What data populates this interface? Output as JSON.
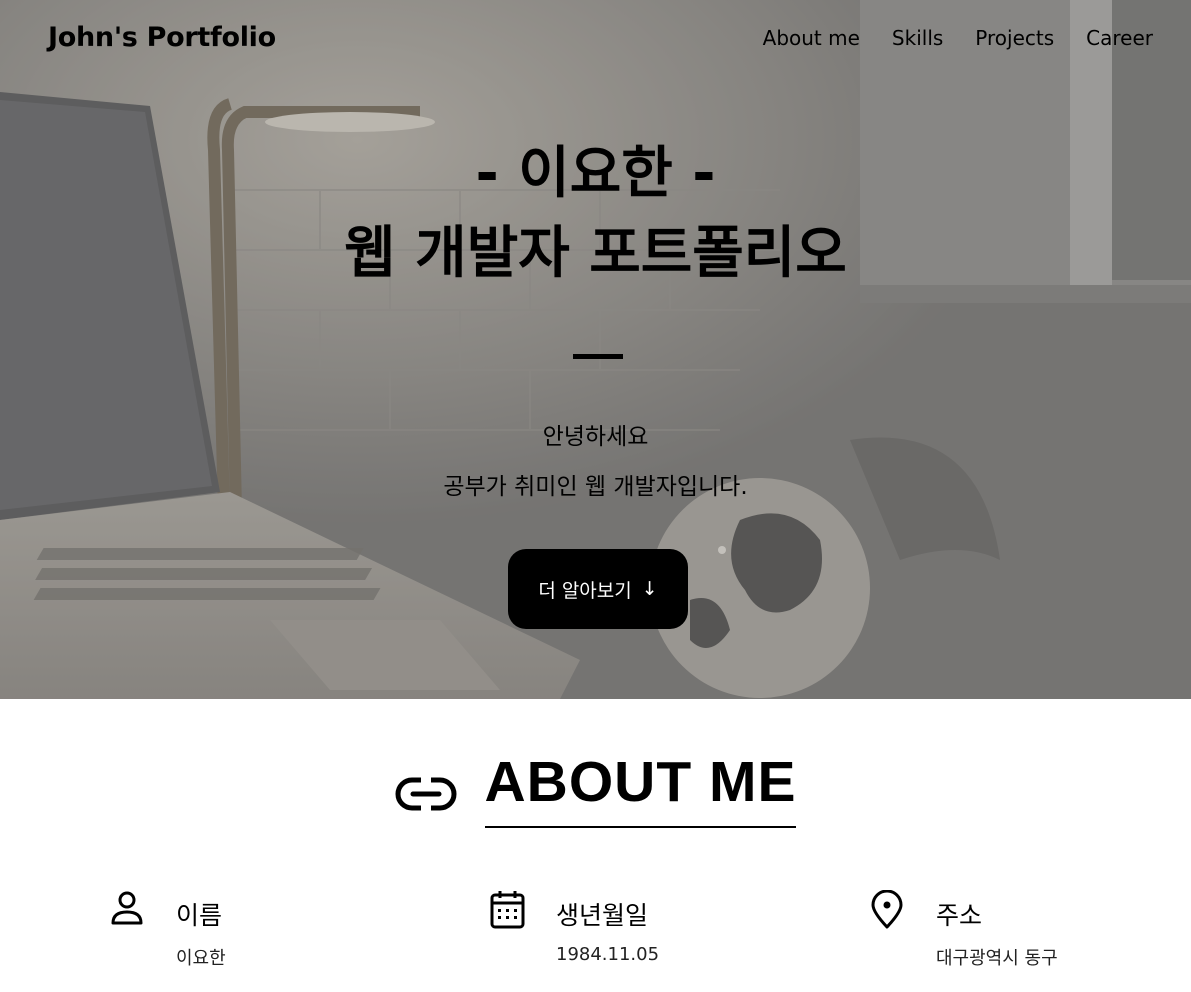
{
  "nav": {
    "brand": "John's Portfolio",
    "links": [
      "About me",
      "Skills",
      "Projects",
      "Career"
    ]
  },
  "hero": {
    "title_line1": "- 이요한 -",
    "title_line2": "웹 개발자 포트폴리오",
    "text_line1": "안녕하세요",
    "text_line2": "공부가 취미인 웹 개발자입니다.",
    "button_label": "더 알아보기",
    "button_arrow": "↓"
  },
  "about": {
    "title": "ABOUT ME",
    "title_icon": "link-icon",
    "items": [
      {
        "icon": "person-icon",
        "label": "이름",
        "value": "이요한"
      },
      {
        "icon": "calendar-icon",
        "label": "생년월일",
        "value": "1984.11.05"
      },
      {
        "icon": "location-pin-icon",
        "label": "주소",
        "value": "대구광역시 동구"
      }
    ]
  },
  "colors": {
    "button_bg": "#000000",
    "hero_overlay": "#808080",
    "text": "#000000"
  }
}
